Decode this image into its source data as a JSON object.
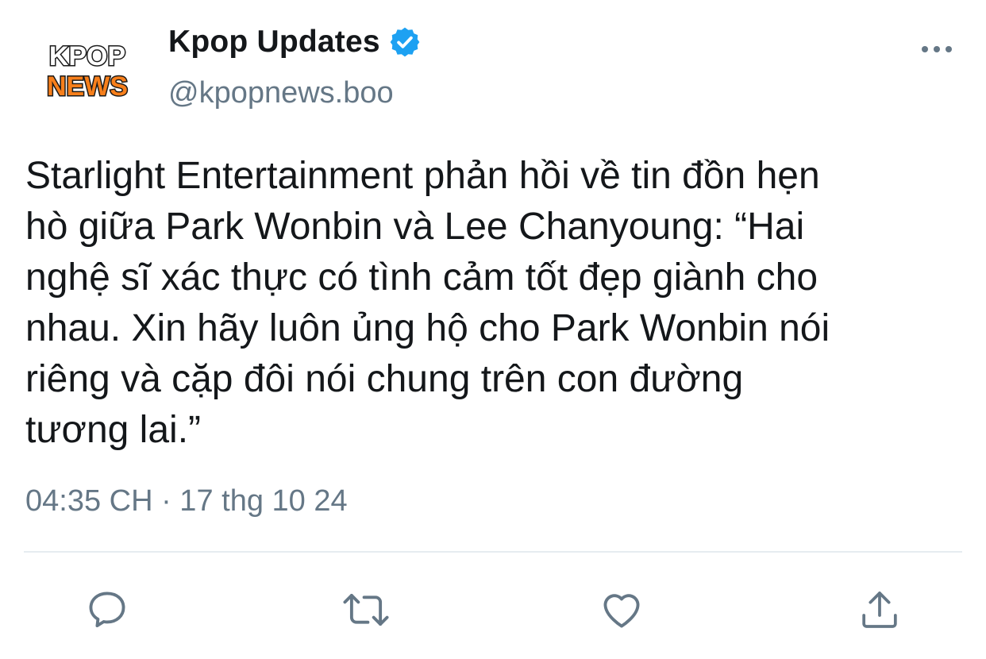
{
  "account": {
    "display_name": "Kpop Updates",
    "handle": "@kpopnews.boo",
    "verified": true,
    "avatar_logo_text": [
      "KPOP",
      "NEWS"
    ]
  },
  "tweet": {
    "lines": [
      "Starlight Entertainment phản hồi về tin đồn hẹn",
      "hò giữa Park Wonbin và Lee Chanyoung: “Hai",
      "nghệ sĩ xác thực có tình cảm tốt đẹp giành cho",
      "nhau. Xin hãy luôn ủng hộ cho Park Wonbin nói",
      "riêng và cặp đôi nói chung trên con đường",
      "tương lai.”"
    ],
    "timestamp": "04:35 CH · 17 thg 10 24"
  },
  "icons": {
    "verified": "verified-badge-icon",
    "more": "more-dots-icon",
    "reply": "reply-icon",
    "retweet": "retweet-icon",
    "like": "heart-icon",
    "share": "share-icon"
  },
  "colors": {
    "text": "#14171a",
    "secondary": "#657786",
    "verified": "#1da1f2",
    "logo_orange": "#f77f1b"
  }
}
